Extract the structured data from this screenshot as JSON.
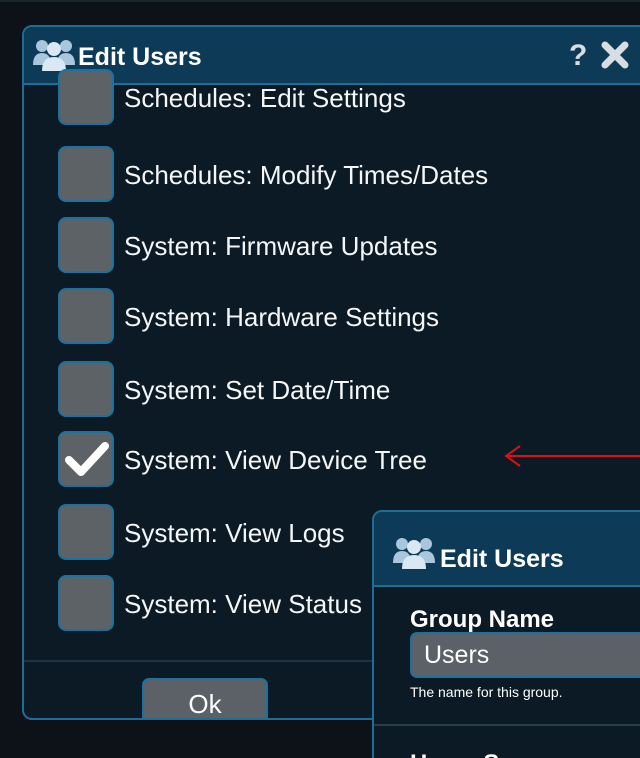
{
  "main_dialog": {
    "title": "Edit Users",
    "title_icon": "users-group-icon",
    "help_label": "?",
    "close_icon": "close-icon",
    "permissions": [
      {
        "label": "Schedules: Edit Settings",
        "checked": false
      },
      {
        "label": "Schedules: Modify Times/Dates",
        "checked": false
      },
      {
        "label": "System: Firmware Updates",
        "checked": false
      },
      {
        "label": "System: Hardware Settings",
        "checked": false
      },
      {
        "label": "System: Set Date/Time",
        "checked": false
      },
      {
        "label": "System: View Device Tree",
        "checked": true
      },
      {
        "label": "System: View Logs",
        "checked": false
      },
      {
        "label": "System: View Status",
        "checked": false
      }
    ],
    "ok_label": "Ok"
  },
  "annotation": {
    "color": "#e01010",
    "icon": "red-arrow-left-icon"
  },
  "second_dialog": {
    "title": "Edit Users",
    "title_icon": "users-group-icon",
    "group_name_label": "Group Name",
    "group_name_value": "Users",
    "group_name_help": "The name for this group.",
    "home_screen_label": "Home Screen"
  },
  "colors": {
    "title_bar": "#0d3a56",
    "accent_border": "#1c6e96",
    "checkbox_fill": "#5d6266",
    "background": "#0b1a24"
  }
}
